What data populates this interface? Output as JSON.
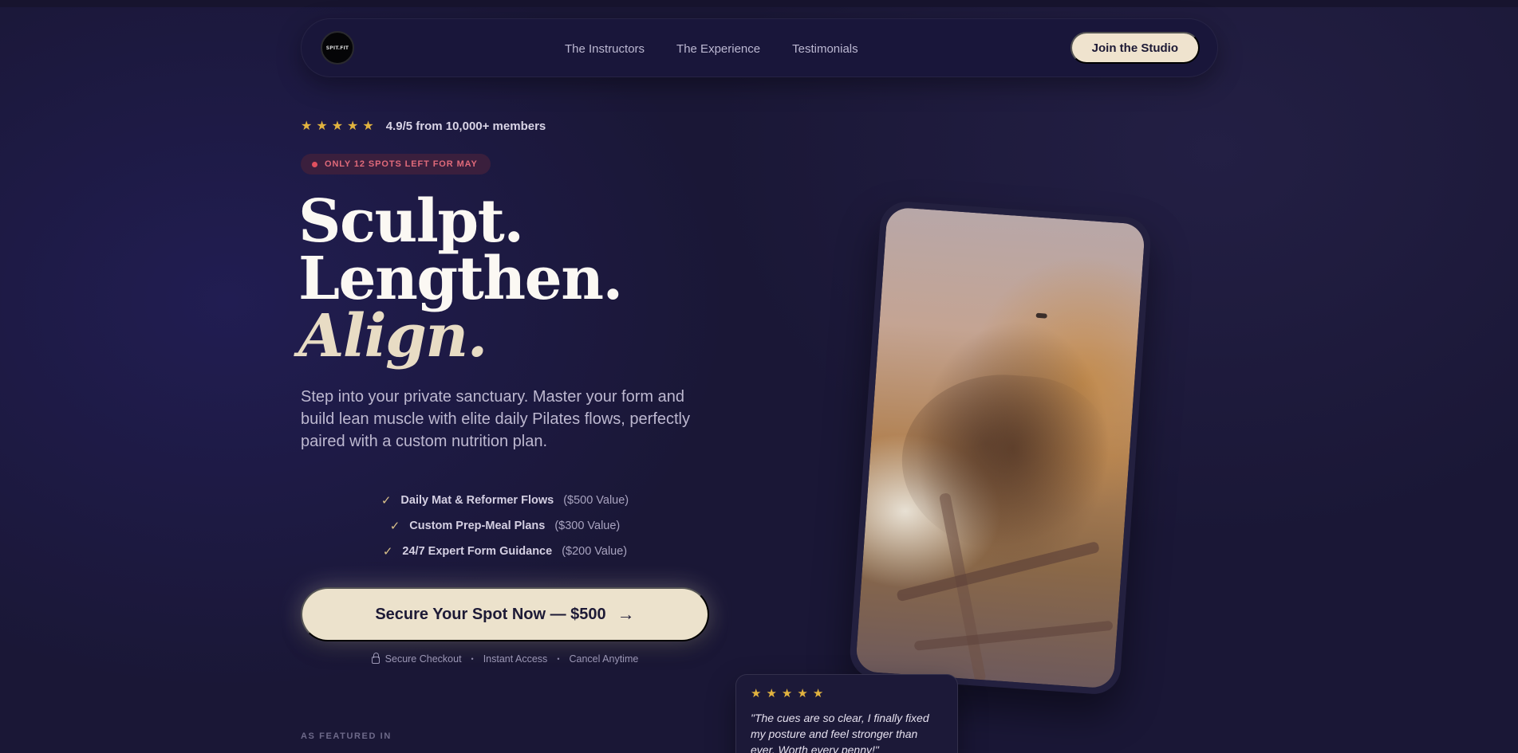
{
  "nav": {
    "logo_text": "SPIT.FIT",
    "links": [
      "The Instructors",
      "The Experience",
      "Testimonials"
    ],
    "cta_label": "Join the Studio"
  },
  "hero": {
    "stars_count": 5,
    "rating_text": "4.9/5 from 10,000+ members",
    "badge_text": "ONLY 12 SPOTS LEFT FOR MAY",
    "headline_line1": "Sculpt.",
    "headline_line2": "Lengthen.",
    "headline_line3": "Align.",
    "subheadline": "Step into your private sanctuary. Master your form and build lean muscle with elite daily Pilates flows, perfectly paired with a custom nutrition plan.",
    "features": [
      {
        "name": "Daily Mat & Reformer Flows",
        "value": "($500 Value)"
      },
      {
        "name": "Custom Prep-Meal Plans",
        "value": "($300 Value)"
      },
      {
        "name": "24/7 Expert Form Guidance",
        "value": "($200 Value)"
      }
    ],
    "cta_label": "Secure Your Spot Now — $500",
    "trust": [
      "Secure Checkout",
      "Instant Access",
      "Cancel Anytime"
    ],
    "featured_label": "AS FEATURED IN"
  },
  "testimonial": {
    "stars_count": 5,
    "quote": "\"The cues are so clear, I finally fixed my posture and feel stronger than ever. Worth every penny!\""
  },
  "colors": {
    "background": "#1a1736",
    "accent_cream": "#ece2cc",
    "star_gold": "#e2b33f",
    "badge_red": "#e06a7a"
  }
}
